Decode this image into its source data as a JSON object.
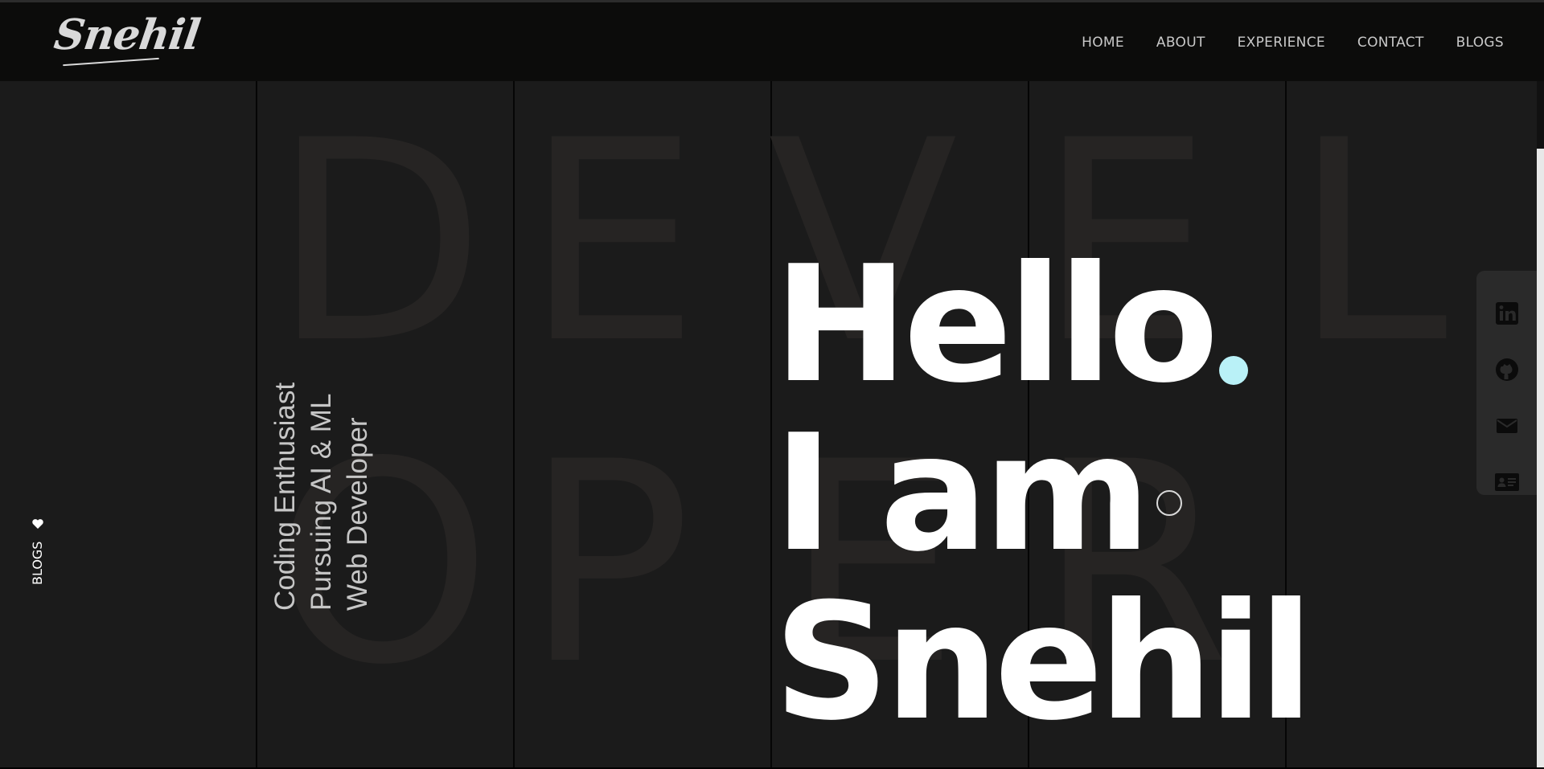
{
  "header": {
    "logo_text": "Snehil",
    "nav": [
      {
        "label": "HOME"
      },
      {
        "label": "ABOUT"
      },
      {
        "label": "EXPERIENCE"
      },
      {
        "label": "CONTACT"
      },
      {
        "label": "BLOGS"
      }
    ]
  },
  "background_word": {
    "row1": [
      "D",
      "E",
      "V",
      "E",
      "L"
    ],
    "row2": [
      "O",
      "P",
      "E",
      "R"
    ]
  },
  "tagline": {
    "lines": [
      "Coding Enthusiast",
      "Pursuing AI & ML",
      "Web Developer"
    ]
  },
  "side_link": {
    "label": "BLOGS",
    "icon": "heart-icon"
  },
  "hero": {
    "line1": "Hello",
    "line2": "I am",
    "line3": "Snehil",
    "dot_color": "#b9f1f7"
  },
  "social": {
    "icons": [
      "linkedin-icon",
      "github-icon",
      "email-icon",
      "resume-card-icon"
    ]
  },
  "colors": {
    "background": "#1b1b1b",
    "header": "#0c0c0b",
    "accent": "#b9f1f7",
    "text": "#ffffff"
  }
}
